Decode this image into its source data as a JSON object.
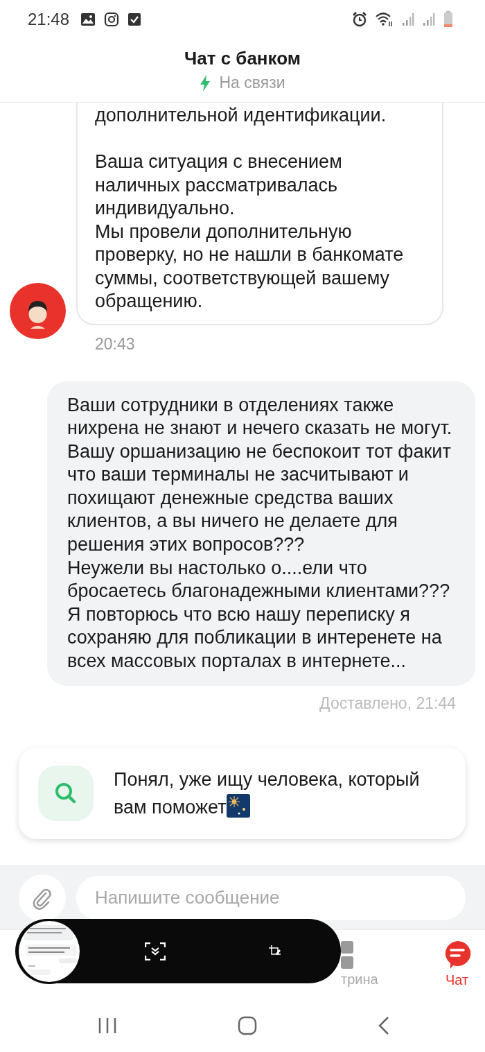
{
  "status_bar": {
    "time": "21:48"
  },
  "header": {
    "title": "Чат с банком",
    "status": "На связи"
  },
  "messages": [
    {
      "kind": "incoming",
      "text": "дополнительной идентификации.\n\nВаша ситуация с внесением наличных рассматривалась индивидуально.\nМы провели дополнительную проверку, но не нашли в банкомате суммы, соответствующей вашему обращению.",
      "time": "20:43"
    },
    {
      "kind": "outgoing",
      "text": "Ваши сотрудники в отделениях также нихрена не знают и нечего сказать не могут. Вашу оршанизацию не беспокоит тот факит что ваши терминалы не засчитывают и похищают денежные средства ваших клиентов, а вы ничего не делаете для решения этих вопросов???\nНеужели вы настолько о....ели что бросаетесь благонадежными клиентами???\nЯ повторюсь что всю нашу переписку я сохраняю для побликации в интеренете на всех массовых порталах в интернете...",
      "status": "Доставлено, 21:44"
    }
  ],
  "system_card": {
    "text": "Понял, уже ищу человека, который вам поможет"
  },
  "composer": {
    "placeholder": "Напишите сообщение"
  },
  "nav": {
    "items": [
      {
        "label": "трина",
        "kind": "showcase",
        "selected": false
      },
      {
        "label": "Чат",
        "kind": "chat",
        "selected": true
      }
    ]
  }
}
